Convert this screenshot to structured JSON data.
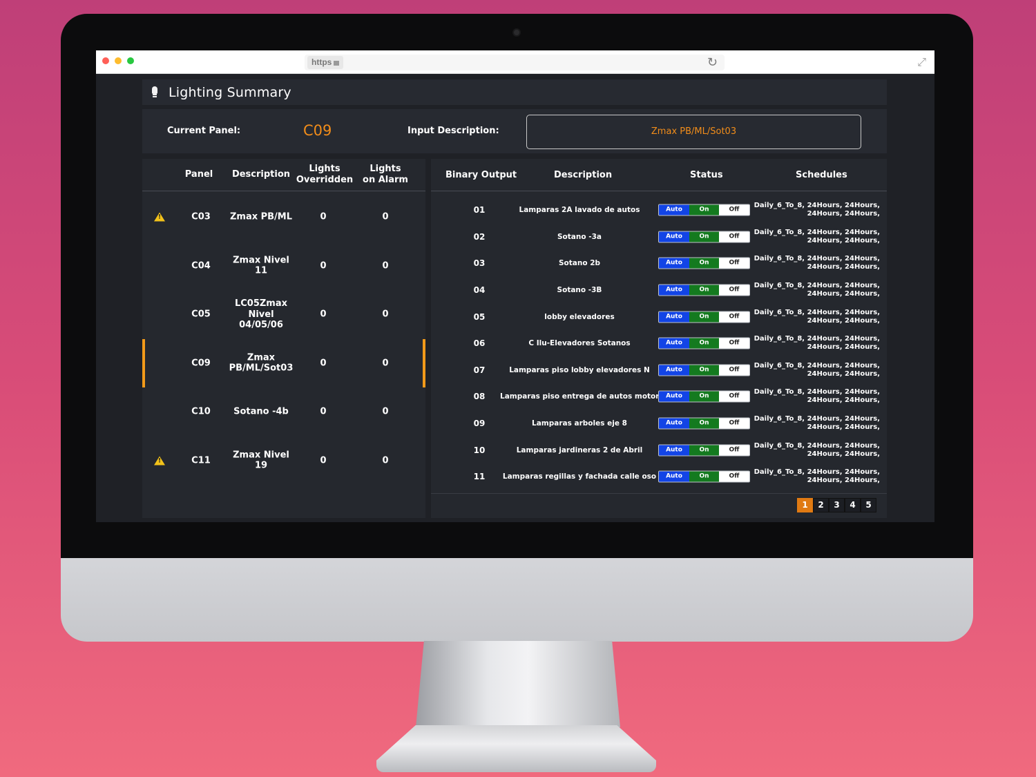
{
  "browser": {
    "url_prefix": "https"
  },
  "app": {
    "title": "Lighting Summary",
    "current_panel_label": "Current Panel:",
    "current_panel_value": "C09",
    "input_description_label": "Input Description:",
    "input_description_value": "Zmax PB/ML/Sot03"
  },
  "panels_table": {
    "headers": {
      "panel": "Panel",
      "description": "Description",
      "overridden_line1": "Lights",
      "overridden_line2": "Overridden",
      "alarm_line1": "Lights",
      "alarm_line2": "on Alarm"
    },
    "rows": [
      {
        "warning": true,
        "panel": "C03",
        "description_line1": "Zmax PB/ML",
        "description_line2": "",
        "description_line3": "",
        "overridden": "0",
        "alarm": "0",
        "selected": false
      },
      {
        "warning": false,
        "panel": "C04",
        "description_line1": "Zmax Nivel 11",
        "description_line2": "",
        "description_line3": "",
        "overridden": "0",
        "alarm": "0",
        "selected": false
      },
      {
        "warning": false,
        "panel": "C05",
        "description_line1": "LC05Zmax",
        "description_line2": "Nivel",
        "description_line3": "04/05/06",
        "overridden": "0",
        "alarm": "0",
        "selected": false
      },
      {
        "warning": false,
        "panel": "C09",
        "description_line1": "Zmax",
        "description_line2": "PB/ML/Sot03",
        "description_line3": "",
        "overridden": "0",
        "alarm": "0",
        "selected": true
      },
      {
        "warning": false,
        "panel": "C10",
        "description_line1": "Sotano -4b",
        "description_line2": "",
        "description_line3": "",
        "overridden": "0",
        "alarm": "0",
        "selected": false
      },
      {
        "warning": true,
        "panel": "C11",
        "description_line1": "Zmax Nivel 19",
        "description_line2": "",
        "description_line3": "",
        "overridden": "0",
        "alarm": "0",
        "selected": false
      }
    ]
  },
  "outputs_table": {
    "headers": {
      "binary_output": "Binary Output",
      "description": "Description",
      "status": "Status",
      "schedules": "Schedules"
    },
    "toggle_labels": {
      "auto": "Auto",
      "on": "On",
      "off": "Off"
    },
    "rows": [
      {
        "num": "01",
        "description": "Lamparas 2A lavado de autos",
        "sched1": "Daily_6_To_8, 24Hours, 24Hours,",
        "sched2": "24Hours, 24Hours,"
      },
      {
        "num": "02",
        "description": "Sotano -3a",
        "sched1": "Daily_6_To_8, 24Hours, 24Hours,",
        "sched2": "24Hours, 24Hours,"
      },
      {
        "num": "03",
        "description": "Sotano 2b",
        "sched1": "Daily_6_To_8, 24Hours, 24Hours,",
        "sched2": "24Hours, 24Hours,"
      },
      {
        "num": "04",
        "description": "Sotano -3B",
        "sched1": "Daily_6_To_8, 24Hours, 24Hours,",
        "sched2": "24Hours, 24Hours,"
      },
      {
        "num": "05",
        "description": "lobby elevadores",
        "sched1": "Daily_6_To_8, 24Hours, 24Hours,",
        "sched2": "24Hours, 24Hours,"
      },
      {
        "num": "06",
        "description": "C Ilu-Elevadores Sotanos",
        "sched1": "Daily_6_To_8, 24Hours, 24Hours,",
        "sched2": "24Hours, 24Hours,"
      },
      {
        "num": "07",
        "description": "Lamparas piso lobby elevadores N",
        "sched1": "Daily_6_To_8, 24Hours, 24Hours,",
        "sched2": "24Hours, 24Hours,"
      },
      {
        "num": "08",
        "description": "Lamparas piso entrega de autos motor",
        "sched1": "Daily_6_To_8, 24Hours, 24Hours,",
        "sched2": "24Hours, 24Hours,"
      },
      {
        "num": "09",
        "description": "Lamparas arboles eje 8",
        "sched1": "Daily_6_To_8, 24Hours, 24Hours,",
        "sched2": "24Hours, 24Hours,"
      },
      {
        "num": "10",
        "description": "Lamparas jardineras 2 de Abril",
        "sched1": "Daily_6_To_8, 24Hours, 24Hours,",
        "sched2": "24Hours, 24Hours,"
      },
      {
        "num": "11",
        "description": "Lamparas regillas y fachada calle oso",
        "sched1": "Daily_6_To_8, 24Hours, 24Hours,",
        "sched2": "24Hours, 24Hours,"
      }
    ],
    "pagination": {
      "pages": [
        "1",
        "2",
        "3",
        "4",
        "5"
      ],
      "active": "1"
    }
  },
  "colors": {
    "accent": "#f28d1a",
    "auto": "#1244e6",
    "on": "#147a1f",
    "warning": "#f2c21a"
  },
  "icons": [
    "lightbulb-icon",
    "warning-icon",
    "reload-icon",
    "fullscreen-icon",
    "lock-icon"
  ]
}
